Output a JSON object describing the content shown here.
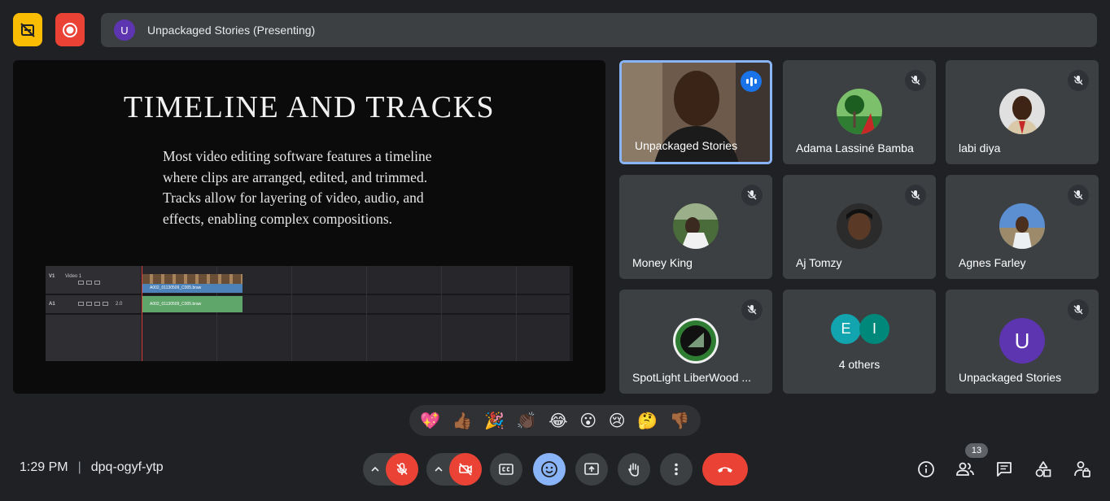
{
  "top_bar": {
    "presenter_initial": "U",
    "presenting_text": "Unpackaged Stories (Presenting)"
  },
  "slide": {
    "title": "TIMELINE AND TRACKS",
    "body": "Most video editing software features a timeline where clips are arranged, edited, and trimmed. Tracks allow for layering of video, audio, and effects, enabling complex compositions.",
    "timeline": {
      "video_track_id": "V1",
      "video_track_name": "Video 1",
      "audio_track_id": "A1",
      "audio_level": "2.0",
      "video_clip": "A002_01130509_C005.braw",
      "audio_clip": "A002_01130509_C005.braw"
    }
  },
  "participants": [
    {
      "name": "Unpackaged Stories",
      "speaking": true
    },
    {
      "name": "Adama Lassiné Bamba",
      "muted": true
    },
    {
      "name": "labi diya",
      "muted": true
    },
    {
      "name": "Money King",
      "muted": true
    },
    {
      "name": "Aj Tomzy",
      "muted": true
    },
    {
      "name": "Agnes Farley",
      "muted": true
    },
    {
      "name": "SpotLight LiberWood ...",
      "muted": true
    },
    {
      "name": "Unpackaged Stories",
      "initial": "U",
      "muted": true
    }
  ],
  "others": {
    "initials": [
      "E",
      "I"
    ],
    "colors": [
      "#12a4af",
      "#00897b"
    ],
    "label": "4 others"
  },
  "reactions": [
    "💖",
    "👍🏾",
    "🎉",
    "👏🏿",
    "😂",
    "😮",
    "😢",
    "🤔",
    "👎🏾"
  ],
  "bottom_bar": {
    "time": "1:29 PM",
    "separator": "|",
    "meeting_code": "dpq-ogyf-ytp",
    "people_count": "13"
  },
  "colors": {
    "background": "#202124",
    "tile": "#3c4043",
    "accent": "#8ab4f8",
    "danger": "#ea4335",
    "warning": "#fbbc04"
  }
}
